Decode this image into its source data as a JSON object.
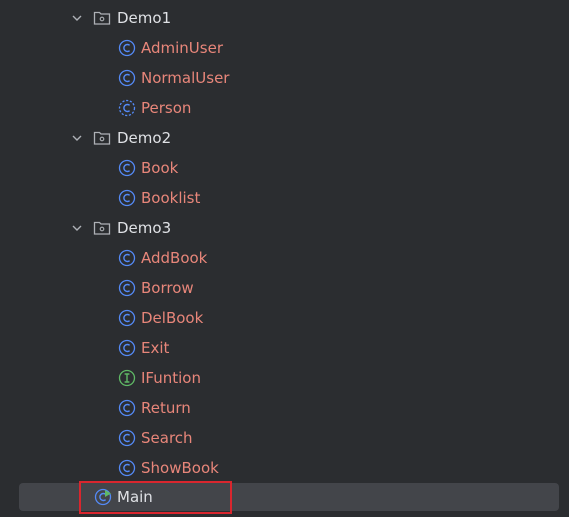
{
  "tree": {
    "folders": [
      {
        "name": "Demo1",
        "children": [
          {
            "name": "AdminUser",
            "kind": "class"
          },
          {
            "name": "NormalUser",
            "kind": "class"
          },
          {
            "name": "Person",
            "kind": "abstract-class"
          }
        ]
      },
      {
        "name": "Demo2",
        "children": [
          {
            "name": "Book",
            "kind": "class"
          },
          {
            "name": "Booklist",
            "kind": "class"
          }
        ]
      },
      {
        "name": "Demo3",
        "children": [
          {
            "name": "AddBook",
            "kind": "class"
          },
          {
            "name": "Borrow",
            "kind": "class"
          },
          {
            "name": "DelBook",
            "kind": "class"
          },
          {
            "name": "Exit",
            "kind": "class"
          },
          {
            "name": "IFuntion",
            "kind": "interface"
          },
          {
            "name": "Return",
            "kind": "class"
          },
          {
            "name": "Search",
            "kind": "class"
          },
          {
            "name": "ShowBook",
            "kind": "class"
          }
        ]
      }
    ],
    "main": {
      "name": "Main",
      "kind": "runnable-class",
      "selected": true
    }
  },
  "colors": {
    "background": "#2b2d30",
    "class_icon": "#548af7",
    "interface_icon": "#5fb865",
    "class_label": "#e8867a",
    "folder_label": "#dfe1e5",
    "selection": "#43454a",
    "highlight_border": "#d9262e"
  }
}
